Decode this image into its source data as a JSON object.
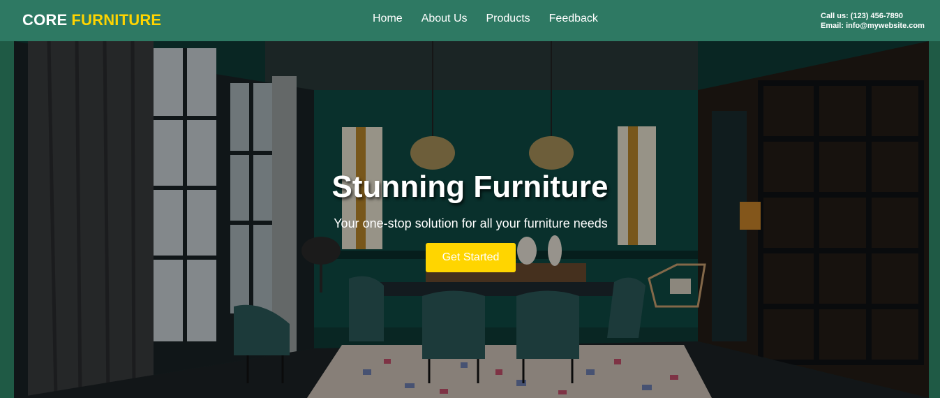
{
  "brand": {
    "part1": "CORE",
    "part2": "FURNITURE"
  },
  "nav": {
    "items": [
      "Home",
      "About Us",
      "Products",
      "Feedback"
    ]
  },
  "contact": {
    "phone": "Call us: (123) 456-7890",
    "email": "Email: info@mywebsite.com"
  },
  "hero": {
    "title": "Stunning Furniture",
    "subtitle": "Your one-stop solution for all your furniture needs",
    "cta_label": "Get Started",
    "image_icon": "dining-room-photo"
  },
  "colors": {
    "header_bg": "#2e7963",
    "accent": "#ffd400",
    "hero_frame": "#1f5a45",
    "button_bg": "#ffd500"
  }
}
